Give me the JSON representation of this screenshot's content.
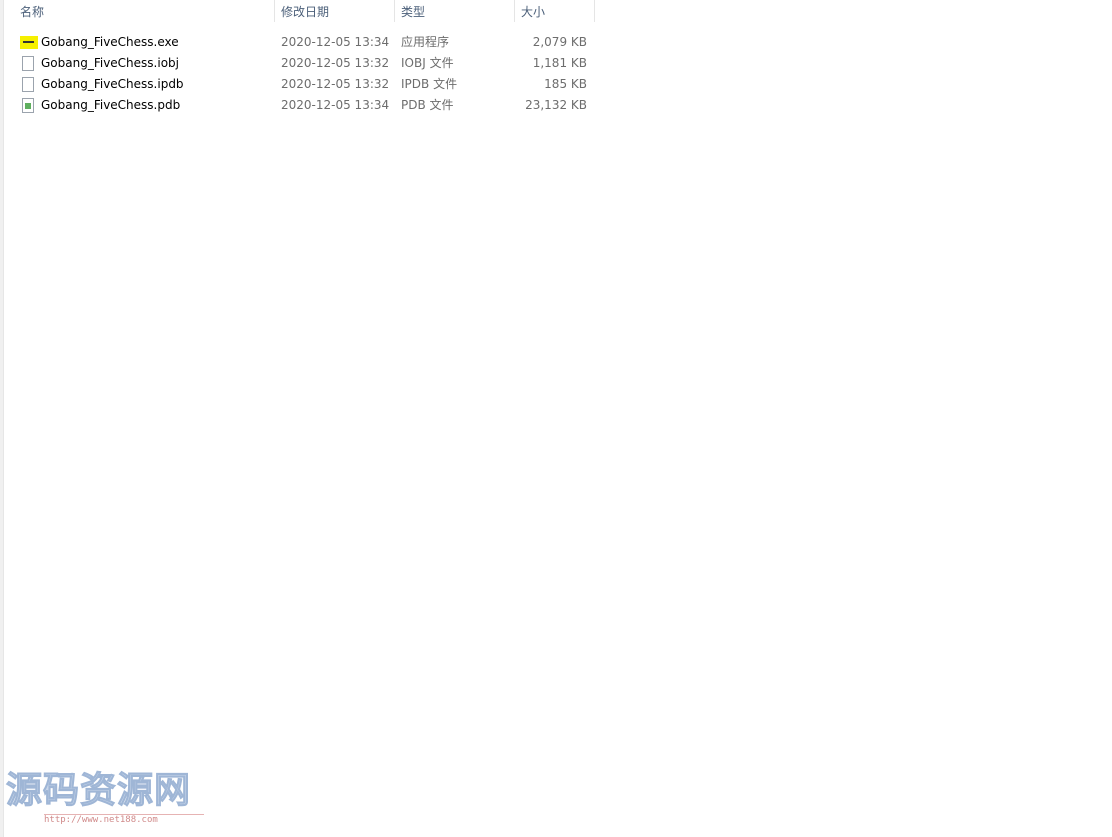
{
  "columns": {
    "name": "名称",
    "date": "修改日期",
    "type": "类型",
    "size": "大小"
  },
  "files": [
    {
      "name": "Gobang_FiveChess.exe",
      "date": "2020-12-05 13:34",
      "type": "应用程序",
      "size": "2,079 KB",
      "icon": "exe-icon"
    },
    {
      "name": "Gobang_FiveChess.iobj",
      "date": "2020-12-05 13:32",
      "type": "IOBJ 文件",
      "size": "1,181 KB",
      "icon": "file-icon"
    },
    {
      "name": "Gobang_FiveChess.ipdb",
      "date": "2020-12-05 13:32",
      "type": "IPDB 文件",
      "size": "185 KB",
      "icon": "file-icon"
    },
    {
      "name": "Gobang_FiveChess.pdb",
      "date": "2020-12-05 13:34",
      "type": "PDB 文件",
      "size": "23,132 KB",
      "icon": "pdb-file-icon"
    }
  ],
  "watermark": {
    "title": "源码资源网",
    "url": "http://www.net188.com"
  },
  "colors": {
    "header_text": "#4c607a",
    "exe_icon": "#f6f000",
    "watermark_title": "#c9d7ea",
    "watermark_url": "#d08a8a"
  }
}
